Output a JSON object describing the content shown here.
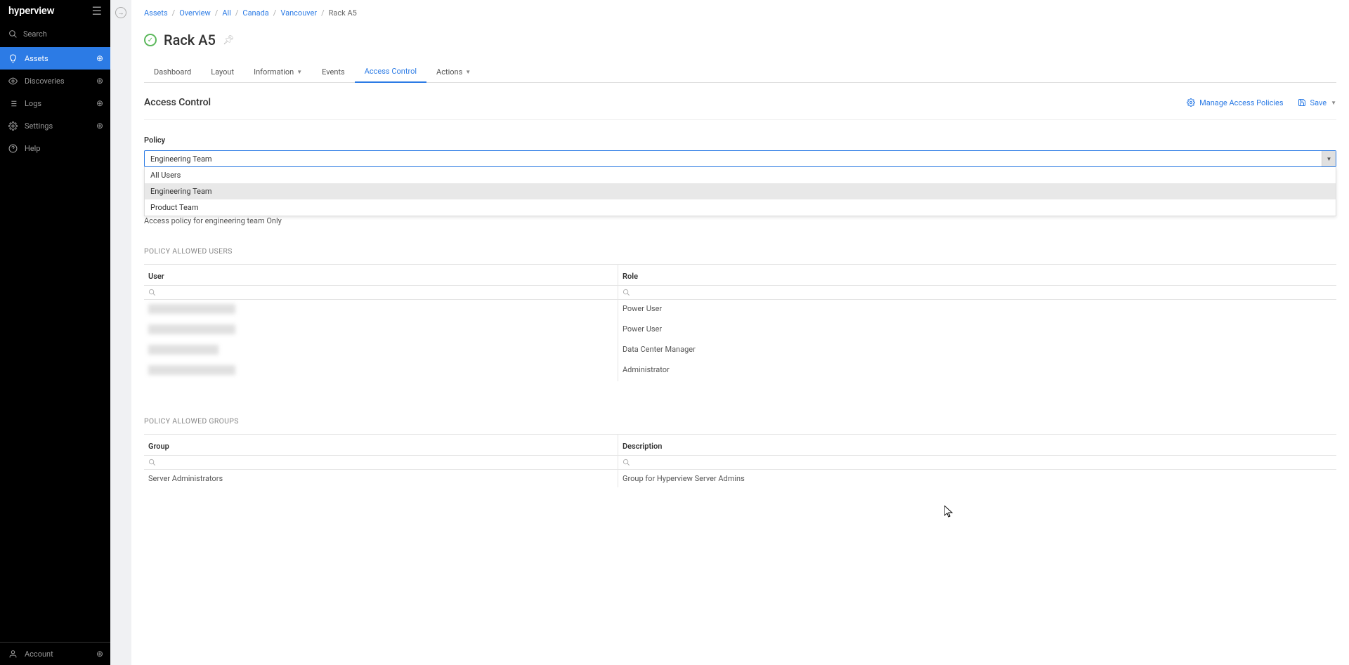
{
  "logo": "hyperview",
  "search": {
    "placeholder": "Search"
  },
  "nav": {
    "items": [
      {
        "label": "Assets",
        "active": true
      },
      {
        "label": "Discoveries",
        "active": false
      },
      {
        "label": "Logs",
        "active": false
      },
      {
        "label": "Settings",
        "active": false
      },
      {
        "label": "Help",
        "active": false
      }
    ],
    "footer": {
      "label": "Account"
    }
  },
  "breadcrumb": {
    "items": [
      "Assets",
      "Overview",
      "All",
      "Canada",
      "Vancouver"
    ],
    "current": "Rack A5"
  },
  "page_title": "Rack A5",
  "tabs": [
    {
      "label": "Dashboard"
    },
    {
      "label": "Layout"
    },
    {
      "label": "Information",
      "dropdown": true
    },
    {
      "label": "Events"
    },
    {
      "label": "Access Control",
      "active": true
    },
    {
      "label": "Actions",
      "dropdown": true
    }
  ],
  "section": {
    "title": "Access Control",
    "actions": {
      "manage": "Manage Access Policies",
      "save": "Save"
    }
  },
  "policy": {
    "label": "Policy",
    "value": "Engineering Team",
    "options": [
      "All Users",
      "Engineering Team",
      "Product Team"
    ],
    "description": "Access policy for engineering team Only"
  },
  "users_section": {
    "header": "POLICY ALLOWED USERS",
    "columns": {
      "user": "User",
      "role": "Role"
    },
    "rows": [
      {
        "user_width": 124,
        "role": "Power User"
      },
      {
        "user_width": 124,
        "role": "Power User"
      },
      {
        "user_width": 100,
        "role": "Data Center Manager"
      },
      {
        "user_width": 124,
        "role": "Administrator"
      }
    ]
  },
  "groups_section": {
    "header": "POLICY ALLOWED GROUPS",
    "columns": {
      "group": "Group",
      "description": "Description"
    },
    "rows": [
      {
        "group": "Server Administrators",
        "description": "Group for Hyperview Server Admins"
      }
    ]
  }
}
